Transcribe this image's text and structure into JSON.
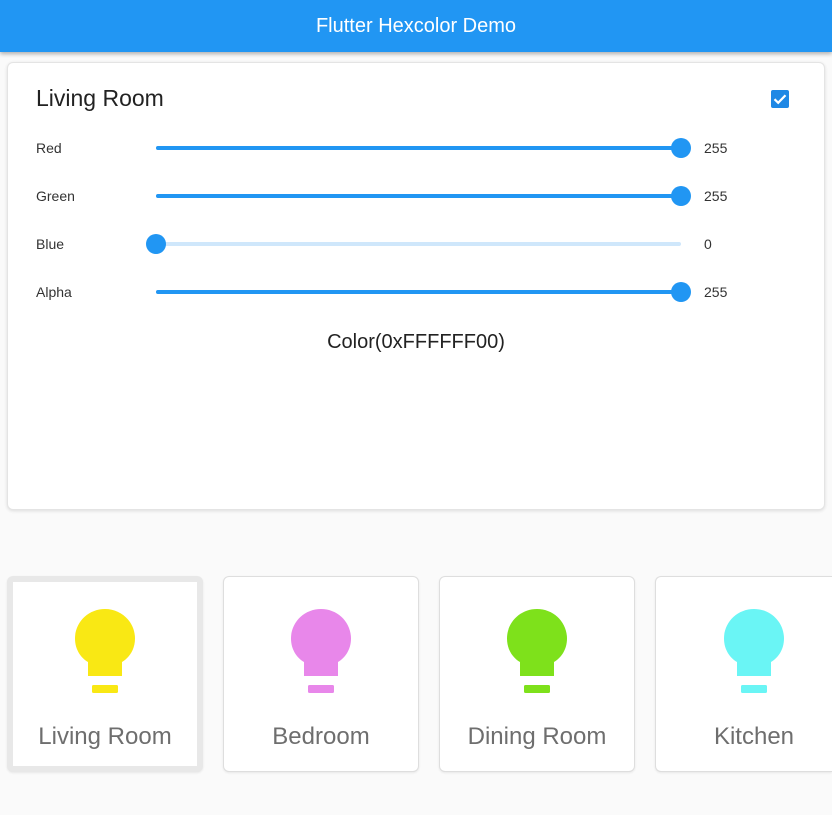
{
  "appbar": {
    "title": "Flutter Hexcolor Demo"
  },
  "panel": {
    "title": "Living Room",
    "checkbox_checked": true,
    "sliders": [
      {
        "label": "Red",
        "value": "255",
        "fraction": 1.0
      },
      {
        "label": "Green",
        "value": "255",
        "fraction": 1.0
      },
      {
        "label": "Blue",
        "value": "0",
        "fraction": 0.0
      },
      {
        "label": "Alpha",
        "value": "255",
        "fraction": 1.0
      }
    ],
    "color_text": "Color(0xFFFFFF00)"
  },
  "rooms": [
    {
      "label": "Living Room",
      "color": "#f9e814",
      "selected": true,
      "icon": "lightbulb-icon"
    },
    {
      "label": "Bedroom",
      "color": "#e887ea",
      "selected": false,
      "icon": "lightbulb-icon"
    },
    {
      "label": "Dining Room",
      "color": "#7ee11b",
      "selected": false,
      "icon": "lightbulb-icon"
    },
    {
      "label": "Kitchen",
      "color": "#6af5f5",
      "selected": false,
      "icon": "lightbulb-icon"
    }
  ],
  "colors": {
    "primary": "#2196f3",
    "track_inactive": "#cfe7fb",
    "checkbox": "#1e88e5"
  }
}
